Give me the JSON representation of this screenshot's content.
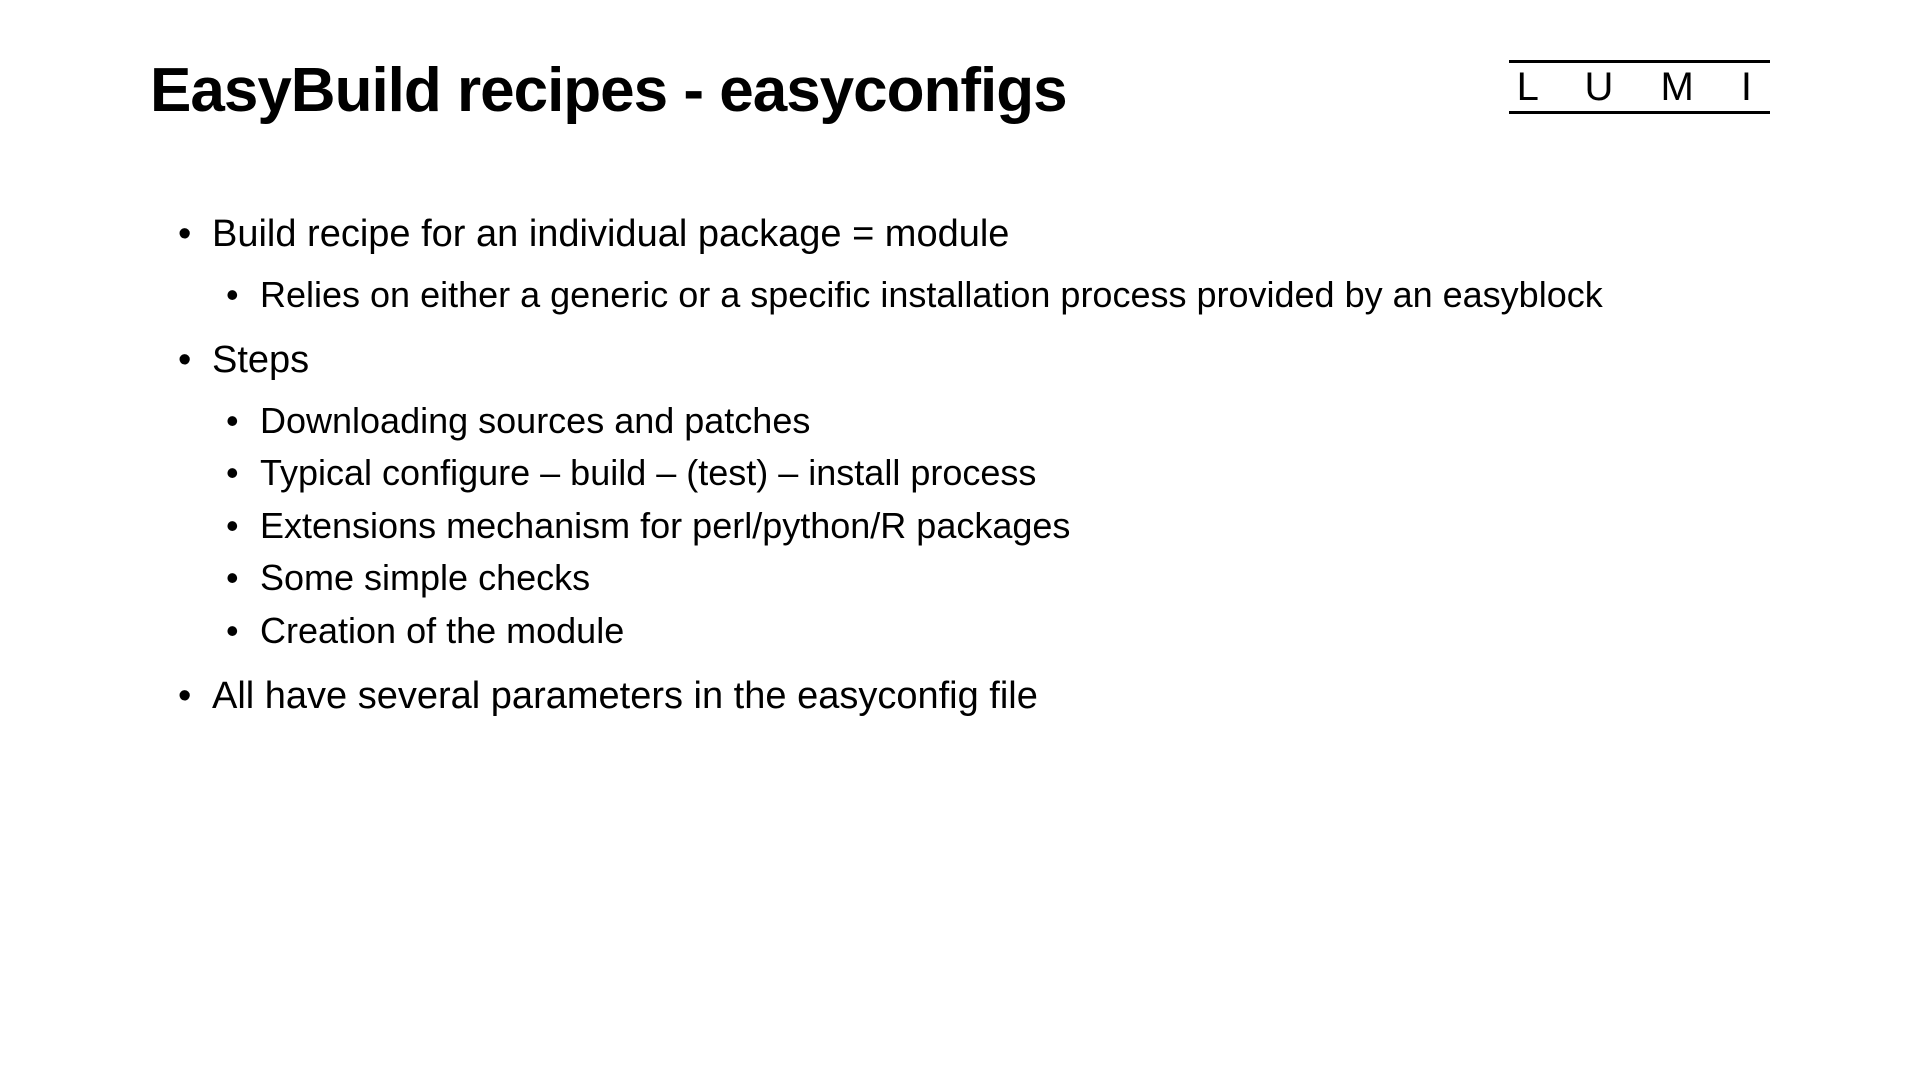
{
  "logo": "L U M I",
  "title": "EasyBuild recipes - easyconfigs",
  "bullets": [
    {
      "text": "Build recipe for an individual package = module",
      "children": [
        "Relies on either a generic or a specific installation process provided by an easyblock"
      ]
    },
    {
      "text": "Steps",
      "children": [
        "Downloading sources and patches",
        "Typical configure – build – (test) – install process",
        "Extensions mechanism for perl/python/R packages",
        "Some simple checks",
        "Creation of the module"
      ]
    },
    {
      "text": "All have several parameters in the easyconfig file",
      "children": []
    }
  ]
}
